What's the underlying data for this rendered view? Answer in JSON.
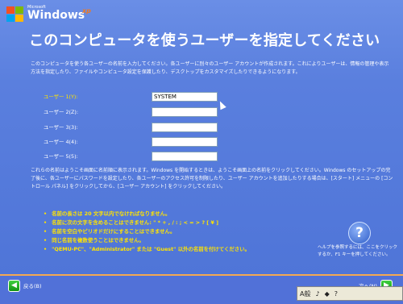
{
  "logo": {
    "microsoft": "Microsoft",
    "windows": "Windows",
    "xp": "xp"
  },
  "title": "このコンピュータを使うユーザーを指定してください",
  "description": "このコンピュータを使う各ユーザーの名前を入力してください。各ユーザーに別々のユーザー アカウントが作成されます。これによりユーザーは、情報の管理や表示方法を指定したり、ファイルやコンピュータ設定を保護したり、デスクトップをカスタマイズしたりできるようになります。",
  "users": [
    {
      "label": "ユーザー 1(Y):",
      "value": "SYSTEM"
    },
    {
      "label": "ユーザー 2(Z):",
      "value": ""
    },
    {
      "label": "ユーザー 3(3):",
      "value": ""
    },
    {
      "label": "ユーザー 4(4):",
      "value": ""
    },
    {
      "label": "ユーザー 5(5):",
      "value": ""
    }
  ],
  "info": "これらの名前はようこそ画面に名前順に表示されます。Windows を開始するときは、ようこそ画面上の名前をクリックしてください。Windows のセットアップの完了後に、各ユーザーにパスワードを設定したり、各ユーザーのアクセス許可を制限したり、ユーザー アカウントを追加したりする場合は、[スタート] メニューの [コントロール パネル] をクリックしてから、[ユーザー アカウント] をクリックしてください。",
  "rules": [
    "名前の長さは 20 文字以内でなければなりません。",
    "名前に次の文字を含めることはできません: \" * + , / : ; < = > ? [ ¥ ]",
    "名前を空白やピリオドだけにすることはできません。",
    "同じ名前を複数使うことはできません。",
    "\"QEMU-PC\"、\"Administrator\" または \"Guest\" 以外の名前を付けてください。"
  ],
  "help": {
    "icon": "?",
    "text": "ヘルプを参照するには、ここをクリックするか、F1 キーを押してください。"
  },
  "nav": {
    "back": "戻る(B)",
    "next": "次へ(N)"
  },
  "ime": {
    "mode": "A般",
    "items": [
      "♪",
      "◆",
      "?"
    ]
  }
}
